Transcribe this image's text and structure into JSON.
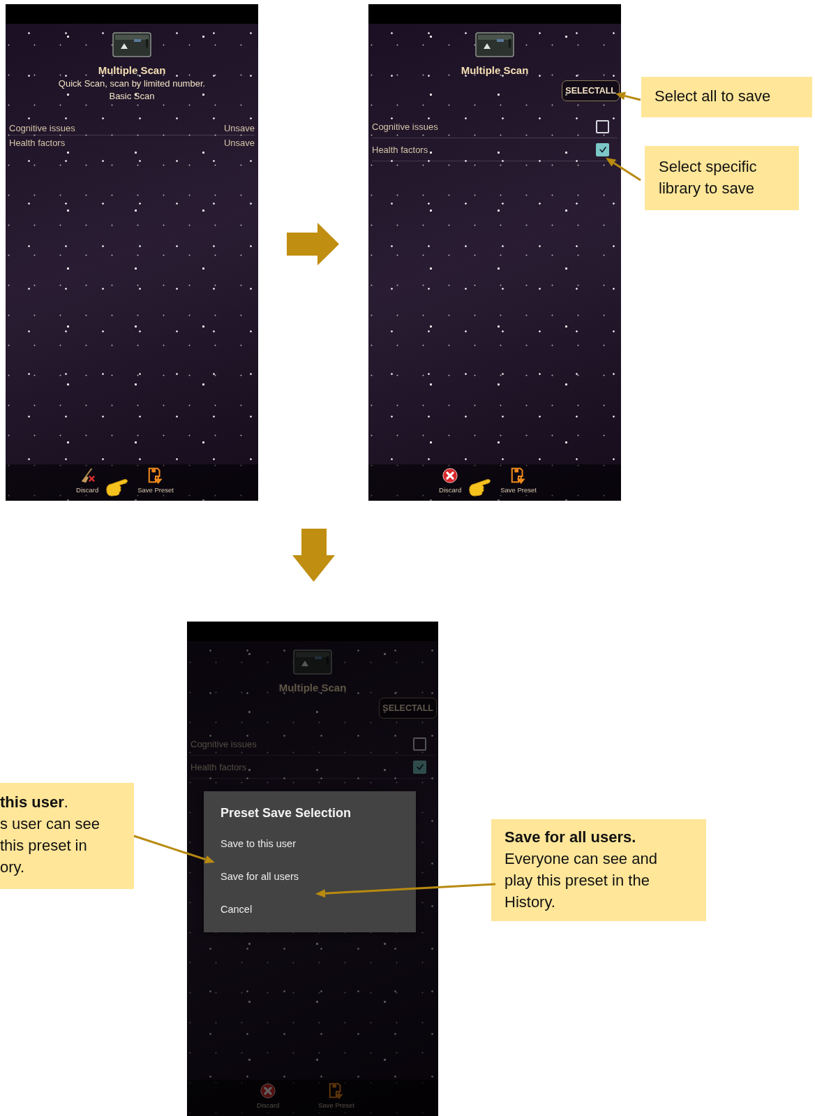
{
  "screens": [
    {
      "kind": "summary",
      "pointer": true,
      "title": "Multiple Scan",
      "subtitle": "Quick Scan, scan by limited number.",
      "description": "Basic Scan",
      "rows": [
        {
          "name": "Cognitive issues",
          "status": "Unsave"
        },
        {
          "name": "Health factors",
          "status": "Unsave"
        }
      ],
      "toolbar": [
        {
          "label": "Discard"
        },
        {
          "label": "Save Preset"
        }
      ]
    },
    {
      "kind": "selection",
      "pointer": true,
      "title": "Multiple Scan",
      "select_all": "SELECTALL",
      "rows": [
        {
          "name": "Cognitive issues",
          "checked": false
        },
        {
          "name": "Health factors",
          "checked": true
        }
      ],
      "toolbar": [
        {
          "label": "Discard"
        },
        {
          "label": "Save Preset"
        }
      ]
    },
    {
      "kind": "selection",
      "dimmed": true,
      "title": "Multiple Scan",
      "select_all": "SELECTALL",
      "rows": [
        {
          "name": "Cognitive issues",
          "checked": false
        },
        {
          "name": "Health factors",
          "checked": true
        }
      ],
      "toolbar": [
        {
          "label": "Discard"
        },
        {
          "label": "Save Preset"
        }
      ],
      "dialog": {
        "title": "Preset Save Selection",
        "options": [
          "Save to this user",
          "Save for all users",
          "Cancel"
        ]
      }
    }
  ],
  "callouts": [
    {
      "kind": "plain",
      "text": "Select all to save"
    },
    {
      "kind": "plain",
      "text": "Select specific library to save"
    },
    {
      "kind": "cut",
      "heading": "**this user**.",
      "lines": [
        "s user can see",
        "this preset in",
        "ory."
      ]
    },
    {
      "kind": "titled",
      "heading": "Save for all users.",
      "body": "Everyone can see and play this preset in the History."
    }
  ]
}
